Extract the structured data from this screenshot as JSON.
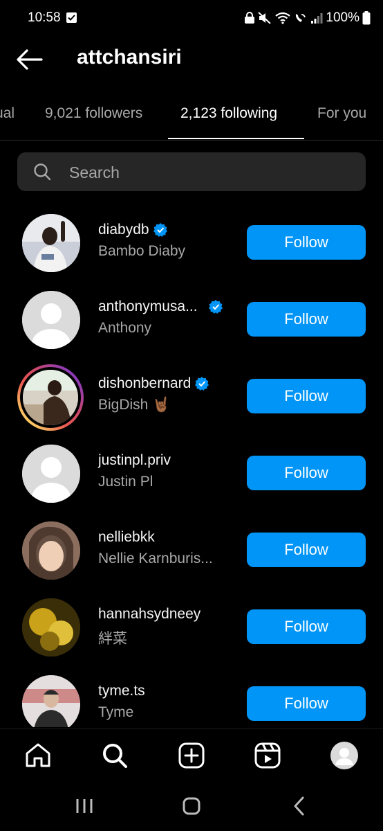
{
  "status": {
    "time": "10:58",
    "battery": "100%"
  },
  "header": {
    "title": "attchansiri"
  },
  "tabs": [
    {
      "label": "Mutual"
    },
    {
      "label": "9,021 followers"
    },
    {
      "label": "2,123 following"
    },
    {
      "label": "For you"
    }
  ],
  "search": {
    "placeholder": "Search"
  },
  "accounts": [
    {
      "username": "diabydb",
      "name": "Bambo Diaby",
      "verified": true,
      "story": false,
      "button": "Follow"
    },
    {
      "username": "anthonymusa...",
      "name": "Anthony",
      "verified": true,
      "story": false,
      "button": "Follow"
    },
    {
      "username": "dishonbernard",
      "name": "BigDish 🤘🏾",
      "verified": true,
      "story": true,
      "button": "Follow"
    },
    {
      "username": "justinpl.priv",
      "name": "Justin Pl",
      "verified": false,
      "story": false,
      "button": "Follow"
    },
    {
      "username": "nelliebkk",
      "name": "Nellie Karnburis...",
      "verified": false,
      "story": false,
      "button": "Follow"
    },
    {
      "username": "hannahsydneey",
      "name": "絆菜",
      "verified": false,
      "story": false,
      "button": "Follow"
    },
    {
      "username": "tyme.ts",
      "name": "Tyme",
      "verified": false,
      "story": false,
      "button": "Follow"
    }
  ],
  "colors": {
    "accent": "#0095f6",
    "background": "#000000",
    "search_bg": "#262626",
    "secondary_text": "#a8a8a8"
  },
  "nav_icons": [
    "home-icon",
    "search-icon",
    "create-icon",
    "reels-icon",
    "profile-avatar"
  ],
  "system_nav": [
    "recents-button",
    "home-button",
    "back-button"
  ]
}
